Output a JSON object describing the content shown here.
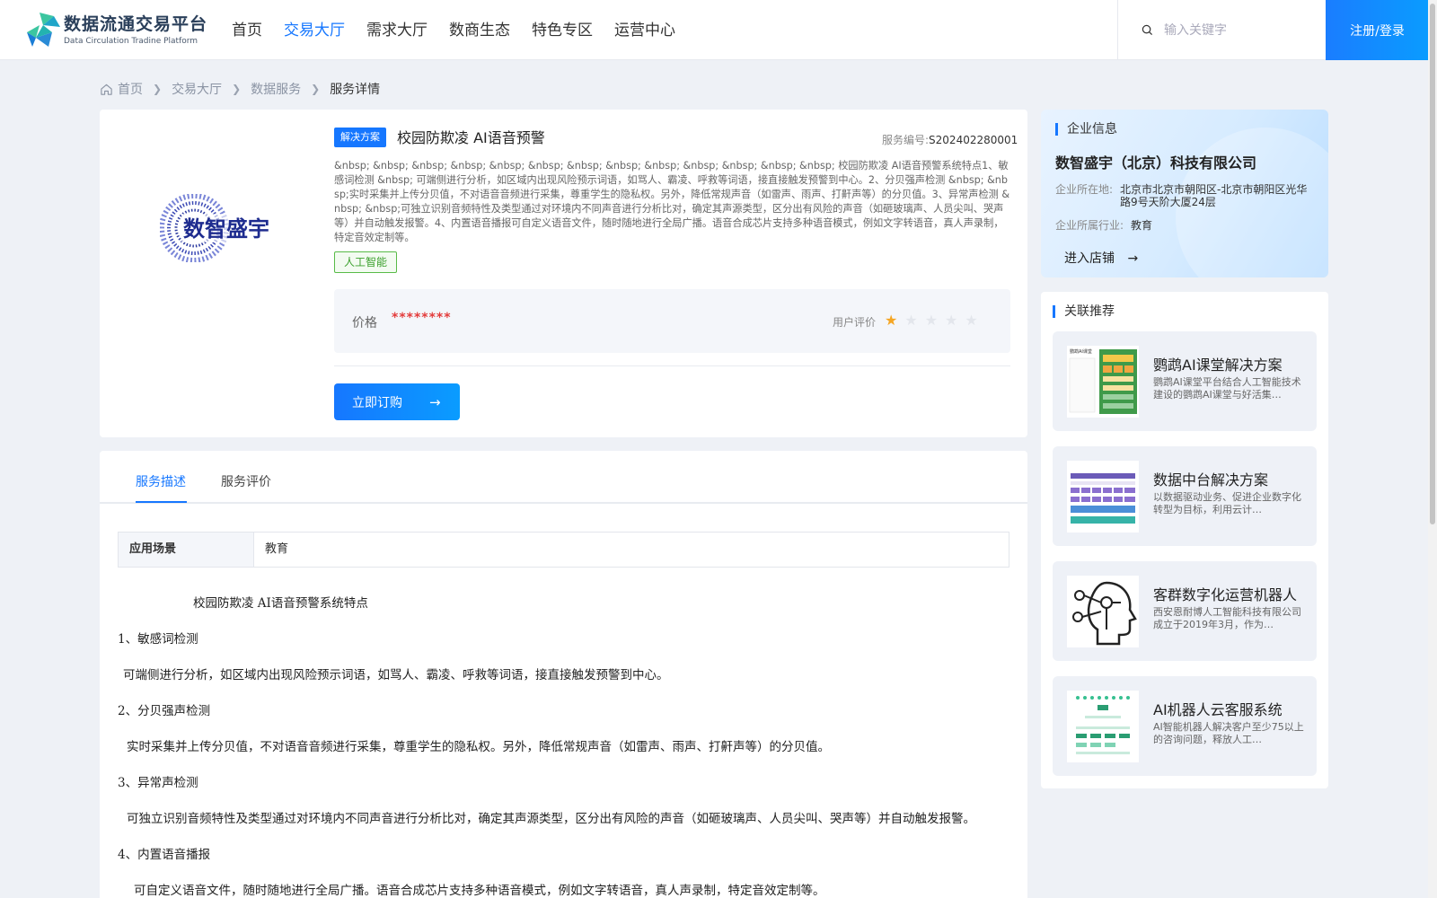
{
  "header": {
    "logo_title": "数据流通交易平台",
    "logo_subtitle": "Data Circulation Tradine Platform",
    "nav": [
      "首页",
      "交易大厅",
      "需求大厅",
      "数商生态",
      "特色专区",
      "运营中心"
    ],
    "active_nav": "交易大厅",
    "search_placeholder": "输入关键字",
    "login_label": "注册/登录"
  },
  "breadcrumb": [
    "首页",
    "交易大厅",
    "数据服务",
    "服务详情"
  ],
  "service": {
    "logo_text": "数智盛宇",
    "type_tag": "解决方案",
    "title": "校园防欺凌 AI语音预警",
    "service_no_label": "服务编号:",
    "service_no": "S202402280001",
    "description": "&nbsp; &nbsp; &nbsp; &nbsp; &nbsp; &nbsp; &nbsp; &nbsp; &nbsp; &nbsp; &nbsp; &nbsp; &nbsp; 校园防欺凌 AI语音预警系统特点1、敏感词检测 &nbsp; 可端侧进行分析，如区域内出现风险预示词语，如骂人、霸凌、呼救等词语，接直接触发预警到中心。2、分贝强声检测 &nbsp; &nbsp;实时采集并上传分贝值，不对语音音频进行采集，尊重学生的隐私权。另外，降低常规声音（如雷声、雨声、打鼾声等）的分贝值。3、异常声检测 &nbsp; &nbsp;可独立识别音频特性及类型通过对环境内不同声音进行分析比对，确定其声源类型，区分出有风险的声音（如砸玻璃声、人员尖叫、哭声等）并自动触发报警。4、内置语音播报可自定义语音文件，随时随地进行全局广播。语音合成芯片支持多种语音模式，例如文字转语音，真人声录制，特定音效定制等。",
    "category_tag": "人工智能",
    "price_label": "价格",
    "price_value": "********",
    "rating_label": "用户评价",
    "rating": 1,
    "rating_max": 5,
    "buy_label": "立即订购"
  },
  "tabs": [
    "服务描述",
    "服务评价"
  ],
  "active_tab": "服务描述",
  "scene": {
    "label": "应用场景",
    "value": "教育"
  },
  "body_lines": [
    "               校园防欺凌 AI语音预警系统特点",
    "1、敏感词检测",
    "  可端侧进行分析，如区域内出现风险预示词语，如骂人、霸凌、呼救等词语，接直接触发预警到中心。",
    "2、分贝强声检测",
    "   实时采集并上传分贝值，不对语音音频进行采集，尊重学生的隐私权。另外，降低常规声音（如雷声、雨声、打鼾声等）的分贝值。",
    "3、异常声检测",
    "   可独立识别音频特性及类型通过对环境内不同声音进行分析比对，确定其声源类型，区分出有风险的声音（如砸玻璃声、人员尖叫、哭声等）并自动触发报警。",
    "4、内置语音播报",
    "     可自定义语音文件，随时随地进行全局广播。语音合成芯片支持多种语音模式，例如文字转语音，真人声录制，特定音效定制等。"
  ],
  "enterprise": {
    "section_title": "企业信息",
    "name": "数智盛宇（北京）科技有限公司",
    "location_label": "企业所在地:",
    "location": "北京市北京市朝阳区-北京市朝阳区光华路9号天阶大厦24层",
    "industry_label": "企业所属行业:",
    "industry": "教育",
    "enter_label": "进入店铺"
  },
  "recommend": {
    "section_title": "关联推荐",
    "thumb_title_0": "鹦鹉AI课堂",
    "items": [
      {
        "title": "鹦鹉AI课堂解决方案",
        "desc": "鹦鹉AI课堂平台结合人工智能技术建设的鹦鹉AI课堂与好活集…"
      },
      {
        "title": "数据中台解决方案",
        "desc": "以数据驱动业务、促进企业数字化转型为目标，利用云计…"
      },
      {
        "title": "客群数字化运营机器人",
        "desc": "西安恩耐博人工智能科技有限公司成立于2019年3月，作为…"
      },
      {
        "title": "AI机器人云客服系统",
        "desc": "AI智能机器人解决客户至少75以上的咨询问题，释放人工…"
      }
    ]
  },
  "colors": {
    "accent": "#1677ff",
    "price": "#e33b3b",
    "tag_green": "#3ba02d",
    "star": "#f5a623"
  }
}
